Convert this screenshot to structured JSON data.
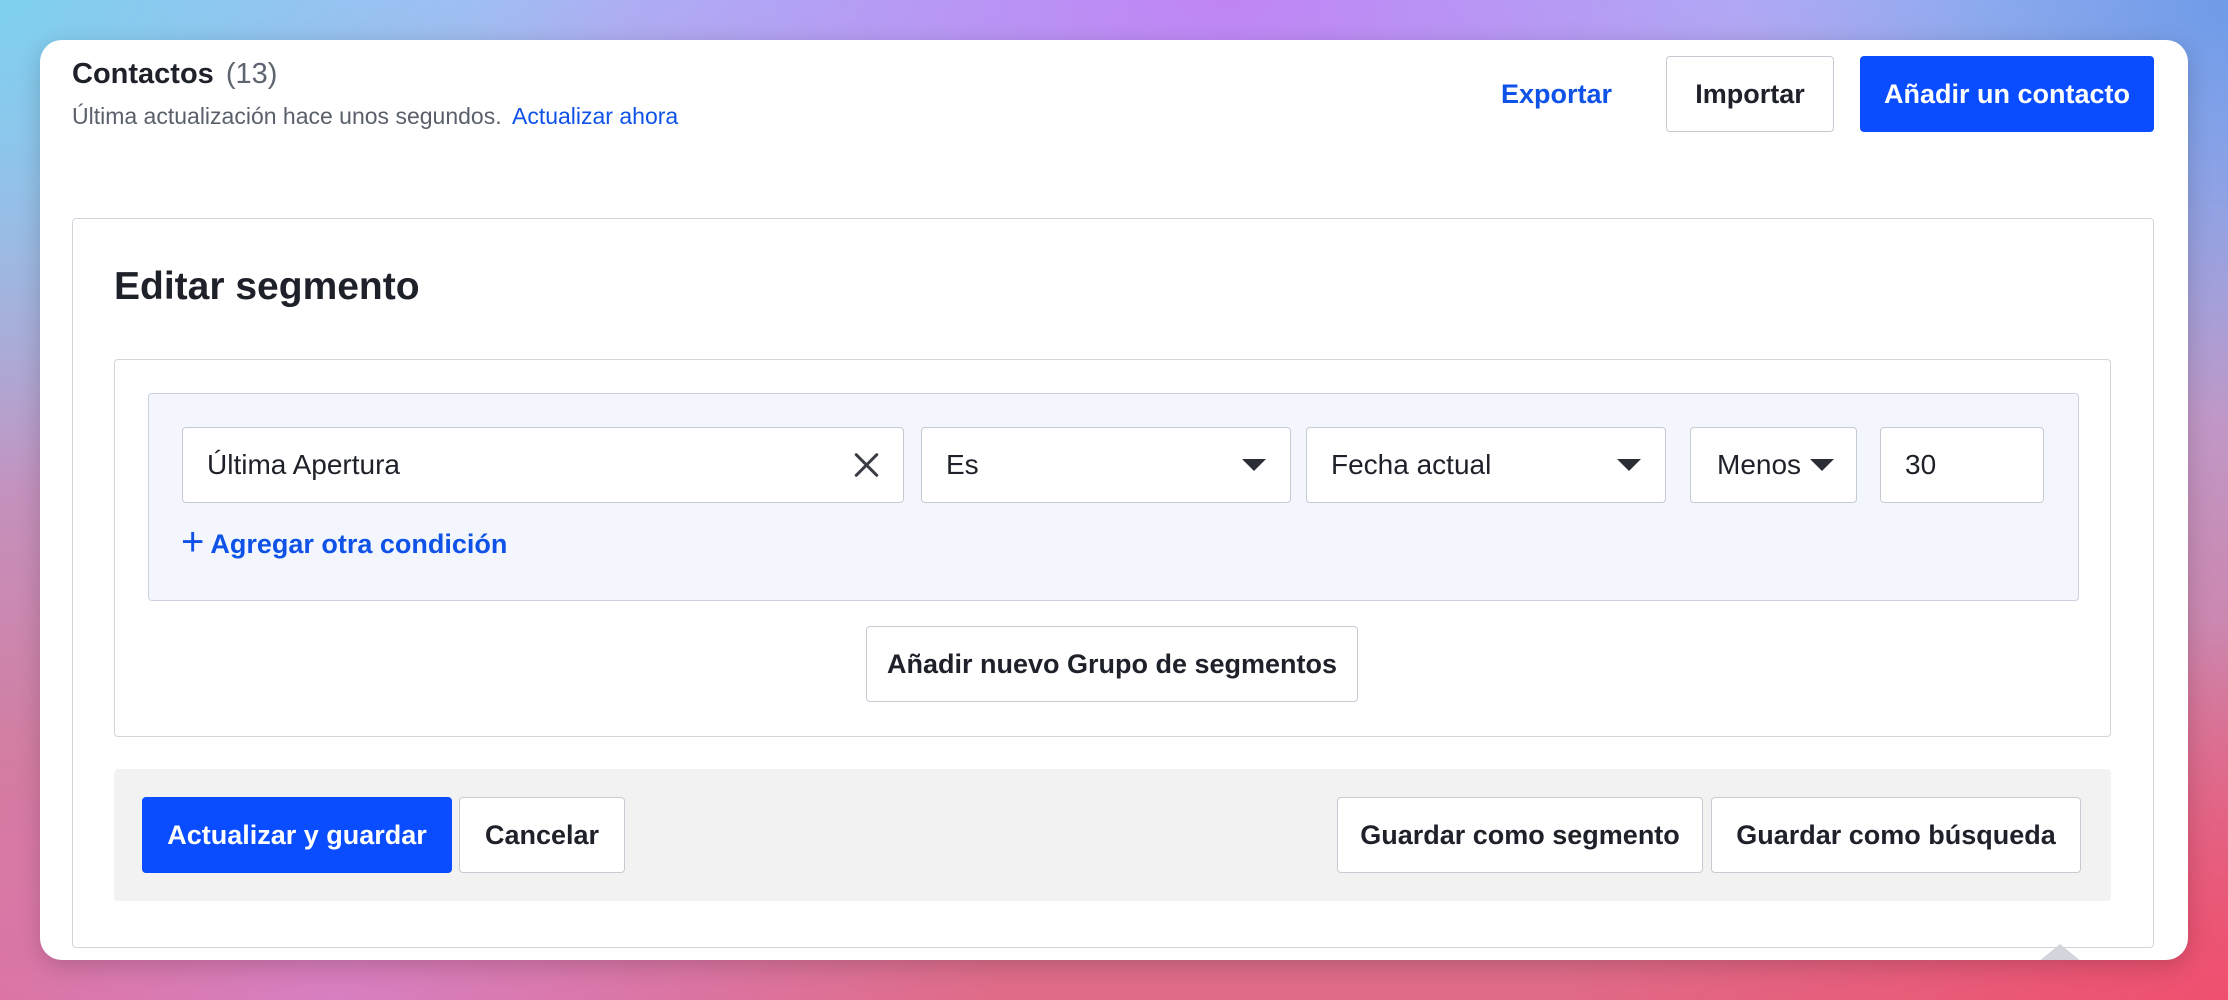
{
  "header": {
    "title": "Contactos",
    "count": "(13)",
    "last_update": "Última actualización hace unos segundos.",
    "refresh_link": "Actualizar ahora",
    "export_label": "Exportar",
    "import_label": "Importar",
    "add_contact_label": "Añadir un contacto"
  },
  "segment_editor": {
    "title": "Editar segmento",
    "condition": {
      "attribute": "Última Apertura",
      "operator": "Es",
      "reference": "Fecha actual",
      "direction": "Menos",
      "amount": "30"
    },
    "add_condition_label": "Agregar otra condición",
    "add_group_label": "Añadir nuevo Grupo de segmentos"
  },
  "footer": {
    "update_save_label": "Actualizar y guardar",
    "cancel_label": "Cancelar",
    "save_segment_label": "Guardar como segmento",
    "save_search_label": "Guardar como búsqueda"
  },
  "colors": {
    "primary": "#0a4cff",
    "link": "#0f52e8",
    "text": "#1e2129",
    "border": "#c6cad2",
    "condition_bg": "#f3f6fc",
    "footer_bg": "#f2f2f3"
  },
  "icons": {
    "clear": "close-icon",
    "dropdown": "caret-down-icon",
    "add": "plus-icon"
  }
}
